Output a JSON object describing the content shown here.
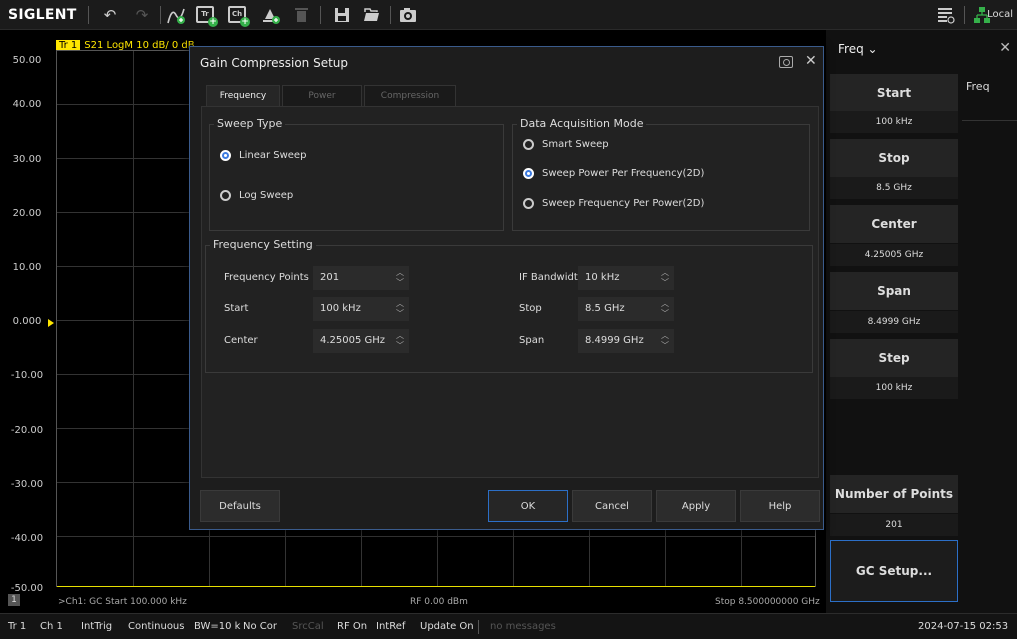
{
  "toolbar": {
    "logo": "SIGLENT",
    "icons": [
      "undo-icon",
      "redo-icon",
      "add-trace-icon",
      "add-trace-window-icon",
      "add-channel-icon",
      "add-marker-icon",
      "delete-icon",
      "save-icon",
      "recall-icon",
      "screenshot-icon",
      "layout-icon",
      "network-icon"
    ],
    "local_label": "Local",
    "box_labels": {
      "tr": "Tr",
      "ch": "Ch"
    }
  },
  "plot": {
    "trace_label": "Tr 1",
    "trace_info": "S21 LogM 10 dB/ 0 dB",
    "y_labels": [
      "50.00",
      "40.00",
      "30.00",
      "20.00",
      "10.00",
      "0.000",
      "-10.00",
      "-20.00",
      "-30.00",
      "-40.00",
      "-50.00"
    ],
    "channel_number": "1",
    "bottom_left": ">Ch1: GC Start 100.000 kHz",
    "bottom_center": "RF 0.00 dBm",
    "bottom_right": "Stop 8.500000000 GHz",
    "trace_color": "#e8e000"
  },
  "statusbar": {
    "items": [
      "Tr 1",
      "Ch 1",
      "IntTrig",
      "Continuous",
      "BW=10 k",
      "No Cor",
      "SrcCal",
      "RF On",
      "IntRef",
      "Update On",
      "no messages"
    ],
    "datetime": "2024-07-15 02:53"
  },
  "right_panel": {
    "title": "Freq",
    "side_tab": "Freq",
    "buttons": [
      {
        "label": "Start",
        "value": "100 kHz"
      },
      {
        "label": "Stop",
        "value": "8.5 GHz"
      },
      {
        "label": "Center",
        "value": "4.25005 GHz"
      },
      {
        "label": "Span",
        "value": "8.4999 GHz"
      },
      {
        "label": "Step",
        "value": "100 kHz"
      }
    ],
    "points_label": "Number of Points",
    "points_value": "201",
    "gc_setup_label": "GC Setup..."
  },
  "dialog": {
    "title": "Gain Compression Setup",
    "tabs": [
      "Frequency",
      "Power",
      "Compression"
    ],
    "sweep_type": {
      "title": "Sweep Type",
      "options": [
        "Linear Sweep",
        "Log Sweep"
      ],
      "selected": "Linear Sweep"
    },
    "acq_mode": {
      "title": "Data Acquisition Mode",
      "options": [
        "Smart Sweep",
        "Sweep Power Per Frequency(2D)",
        "Sweep Frequency Per Power(2D)"
      ],
      "selected": "Sweep Power Per Frequency(2D)"
    },
    "freq_setting": {
      "title": "Frequency Setting",
      "points_label": "Frequency Points",
      "points_value": "201",
      "start_label": "Start",
      "start_value": "100 kHz",
      "center_label": "Center",
      "center_value": "4.25005 GHz",
      "ifbw_label": "IF Bandwidth",
      "ifbw_value": "10 kHz",
      "stop_label": "Stop",
      "stop_value": "8.5 GHz",
      "span_label": "Span",
      "span_value": "8.4999 GHz"
    },
    "buttons": {
      "defaults": "Defaults",
      "ok": "OK",
      "cancel": "Cancel",
      "apply": "Apply",
      "help": "Help"
    }
  }
}
